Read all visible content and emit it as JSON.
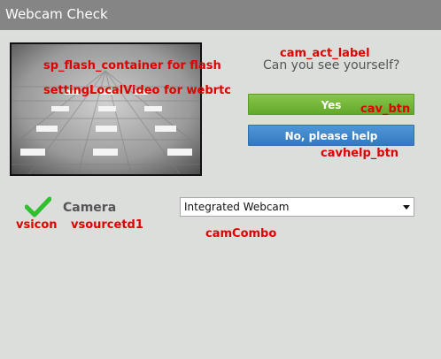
{
  "window": {
    "title": "Webcam Check"
  },
  "prompt": {
    "question": "Can you see yourself?"
  },
  "buttons": {
    "yes_label": "Yes",
    "help_label": "No, please help"
  },
  "source": {
    "status_icon": "checkmark-icon",
    "label": "Camera",
    "selected_camera": "Integrated Webcam"
  },
  "annotations": {
    "flash_container": "sp_flash_container for flash",
    "local_video": "settingLocalVideo for webrtc",
    "cam_act_label": "cam_act_label",
    "cav_btn": "cav_btn",
    "cavhelp_btn": "cavhelp_btn",
    "vsicon": "vsicon",
    "vsourcetd1": "vsourcetd1",
    "camCombo": "camCombo"
  },
  "colors": {
    "title_bar": "#858585",
    "background": "#dcdedc",
    "yes_button": "#6fb336",
    "help_button": "#3e86cc",
    "check_icon": "#2fbf2f",
    "annotation_text": "#e00000"
  }
}
